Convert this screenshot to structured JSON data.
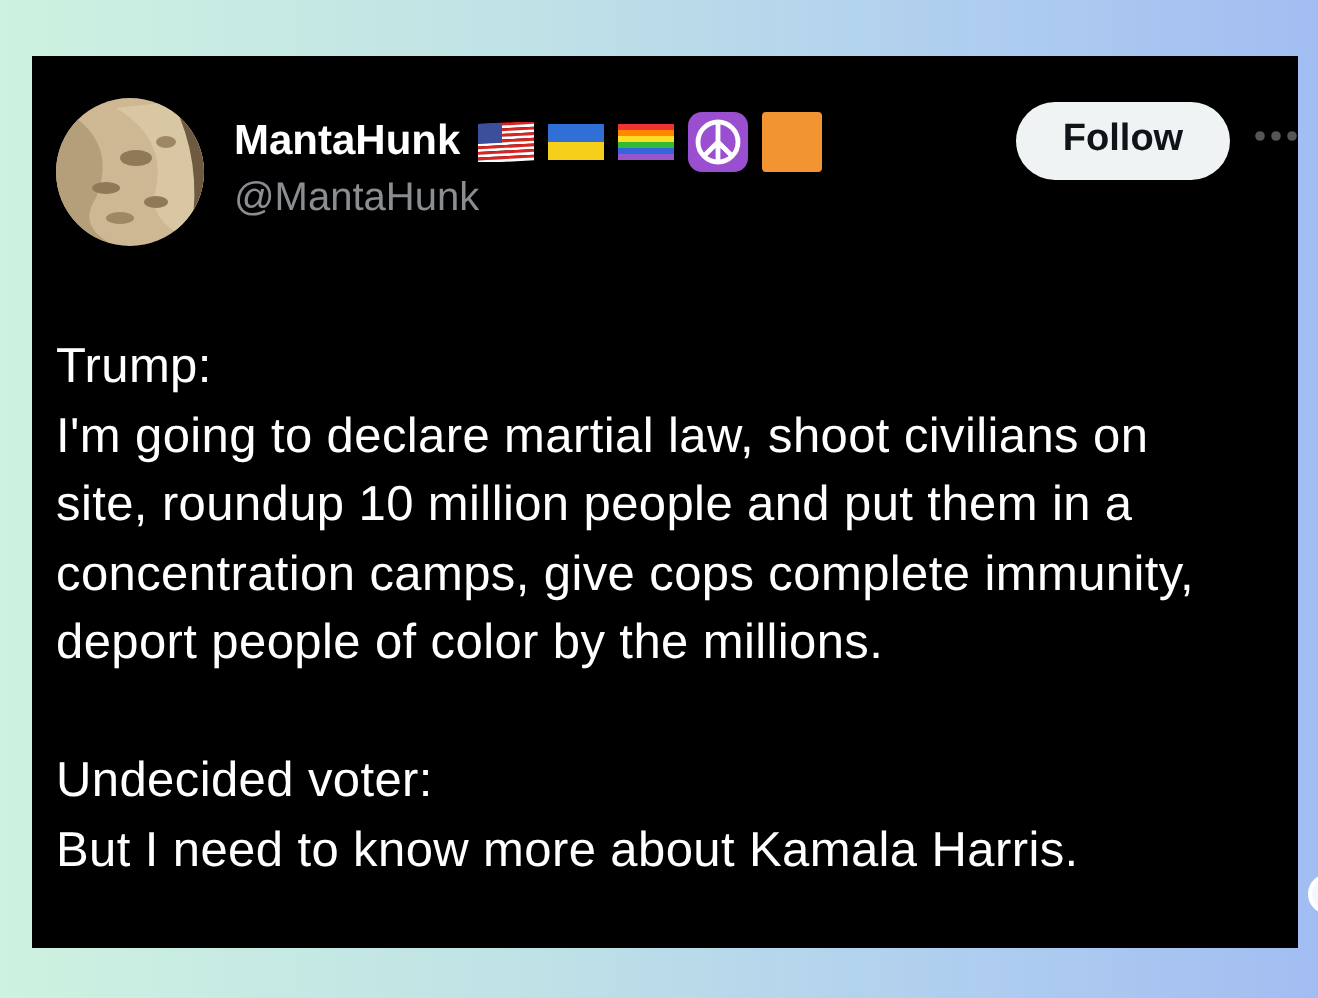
{
  "author": {
    "name": "MantaHunk",
    "handle": "@MantaHunk"
  },
  "name_badges": [
    {
      "kind": "us-flag"
    },
    {
      "kind": "ukraine-flag"
    },
    {
      "kind": "rainbow-flag"
    },
    {
      "kind": "peace"
    },
    {
      "kind": "orange-square"
    }
  ],
  "follow_button": {
    "label": "Follow"
  },
  "paragraphs": [
    {
      "lines": [
        "Trump:",
        "I'm going to declare martial law, shoot civilians on site, roundup 10 million people and put them in a concentration camps, give cops complete immunity, deport people of color by the millions."
      ]
    },
    {
      "lines": [
        "Undecided voter:",
        "But I need to know more about Kamala Harris."
      ]
    }
  ]
}
